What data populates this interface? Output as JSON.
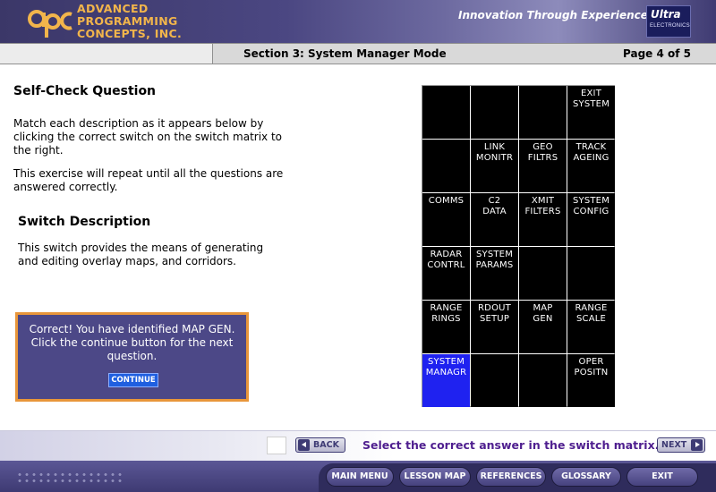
{
  "header": {
    "company_lines": [
      "ADVANCED",
      "PROGRAMMING",
      "CONCEPTS, INC."
    ],
    "logo_letters": "apc",
    "tagline": "Innovation Through Experience",
    "partner_logo": {
      "name": "Ultra",
      "subtitle": "ELECTRONICS"
    },
    "colors": {
      "brand_orange": "#f2b54b",
      "header_purple": "#4b4782"
    }
  },
  "section_bar": {
    "title": "Section 3: System Manager Mode",
    "page": "Page 4 of 5"
  },
  "content": {
    "question_heading": "Self-Check Question",
    "instructions": [
      "Match each description as it appears below by clicking the correct switch on the switch matrix to the right.",
      "This exercise will repeat until all the questions are answered correctly."
    ],
    "switch_description_heading": "Switch Description",
    "switch_description": "This switch provides the means of generating and editing overlay maps, and corridors."
  },
  "feedback": {
    "message": "Correct! You have identified MAP GEN. Click the continue button for the next question.",
    "continue_label": "CONTINUE",
    "colors": {
      "box": "#4c4887",
      "border": "#e8963a",
      "button": "#1f5fe0"
    }
  },
  "switch_matrix": {
    "selected_color": "#1f22f0",
    "rows": [
      [
        {
          "label": ""
        },
        {
          "label": ""
        },
        {
          "label": ""
        },
        {
          "label": "EXIT\nSYSTEM"
        }
      ],
      [
        {
          "label": ""
        },
        {
          "label": "LINK\nMONITR"
        },
        {
          "label": "GEO\nFILTRS"
        },
        {
          "label": "TRACK\nAGEING"
        }
      ],
      [
        {
          "label": "COMMS"
        },
        {
          "label": "C2\nDATA"
        },
        {
          "label": "XMIT\nFILTERS"
        },
        {
          "label": "SYSTEM\nCONFIG"
        }
      ],
      [
        {
          "label": "RADAR\nCONTRL"
        },
        {
          "label": "SYSTEM\nPARAMS"
        },
        {
          "label": ""
        },
        {
          "label": ""
        }
      ],
      [
        {
          "label": "RANGE\nRINGS"
        },
        {
          "label": "RDOUT\nSETUP"
        },
        {
          "label": "MAP\nGEN"
        },
        {
          "label": "RANGE\nSCALE"
        }
      ],
      [
        {
          "label": "SYSTEM\nMANAGR",
          "selected": true
        },
        {
          "label": ""
        },
        {
          "label": ""
        },
        {
          "label": "OPER\nPOSITN"
        }
      ]
    ]
  },
  "nav": {
    "back_label": "BACK",
    "next_label": "NEXT",
    "instruction": "Select the correct answer in the switch matrix."
  },
  "footer": {
    "main_menu": "MAIN MENU",
    "lesson_map": "LESSON MAP",
    "references": "REFERENCES",
    "glossary": "GLOSSARY",
    "exit": "EXIT"
  }
}
